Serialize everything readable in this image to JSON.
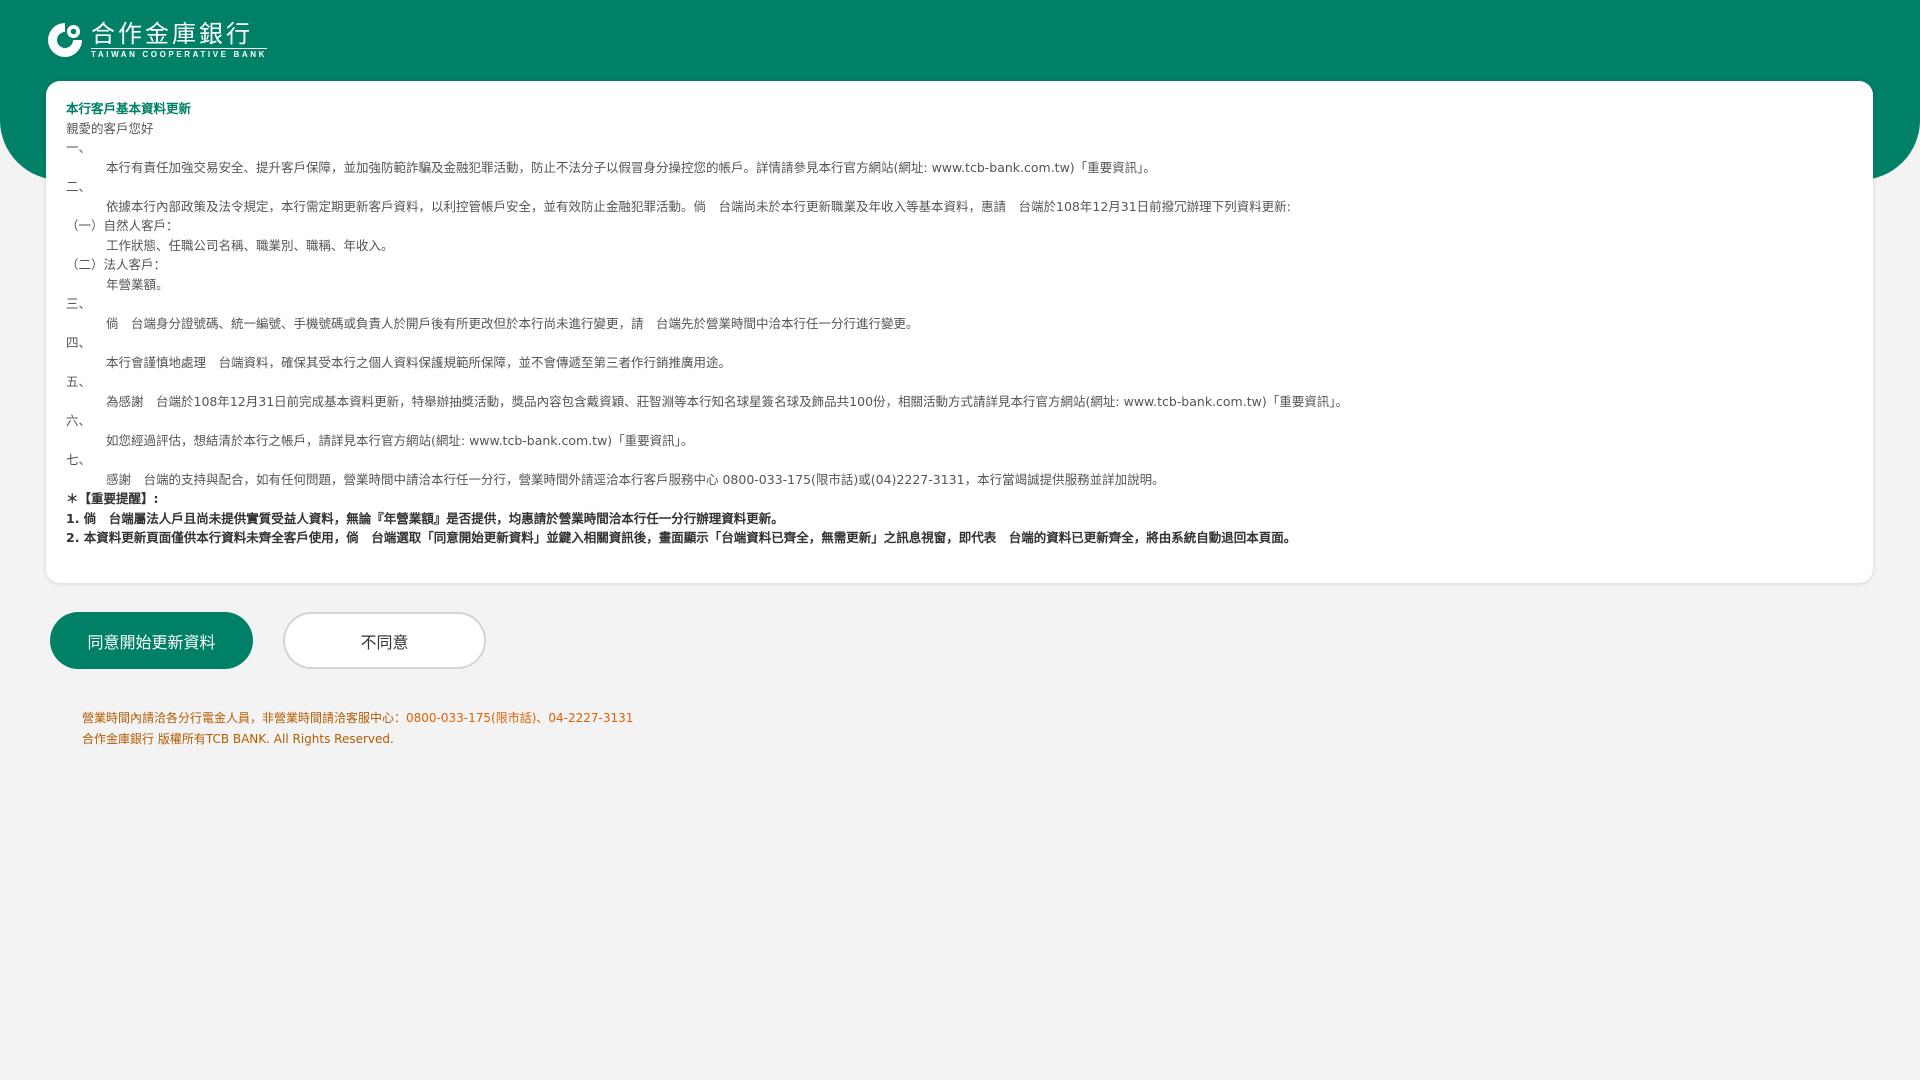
{
  "header": {
    "logo_cn": "合作金庫銀行",
    "logo_en": "TAIWAN COOPERATIVE BANK"
  },
  "notice": {
    "title": "本行客戶基本資料更新",
    "greeting": "親愛的客戶您好",
    "sections": [
      {
        "num": "一、",
        "text": "本行有責任加強交易安全、提升客戶保障，並加強防範詐騙及金融犯罪活動，防止不法分子以假冒身分操控您的帳戶。詳情請參見本行官方網站(網址: www.tcb-bank.com.tw)「重要資訊」。"
      },
      {
        "num": "二、",
        "text": "依據本行內部政策及法令規定，本行需定期更新客戶資料，以利控管帳戶安全，並有效防止金融犯罪活動。倘　台端尚未於本行更新職業及年收入等基本資料，惠請　台端於108年12月31日前撥冗辦理下列資料更新:"
      },
      {
        "num": "（一）",
        "text": "自然人客戶："
      },
      {
        "num": "",
        "text": "工作狀態、任職公司名稱、職業別、職稱、年收入。"
      },
      {
        "num": "（二）",
        "text": "法人客戶："
      },
      {
        "num": "",
        "text": "年營業額。"
      },
      {
        "num": "三、",
        "text": "倘　台端身分證號碼、統一編號、手機號碼或負責人於開戶後有所更改但於本行尚未進行變更，請　台端先於營業時間中洽本行任一分行進行變更。"
      },
      {
        "num": "四、",
        "text": "本行會謹慎地處理　台端資料，確保其受本行之個人資料保護規範所保障，並不會傳遞至第三者作行銷推廣用途。"
      },
      {
        "num": "五、",
        "text": "為感謝　台端於108年12月31日前完成基本資料更新，特舉辦抽獎活動，獎品內容包含戴資穎、莊智淵等本行知名球星簽名球及飾品共100份，相關活動方式請詳見本行官方網站(網址: www.tcb-bank.com.tw)「重要資訊」。"
      },
      {
        "num": "六、",
        "text": "如您經過評估，想結清於本行之帳戶，請詳見本行官方網站(網址: www.tcb-bank.com.tw)「重要資訊」。"
      },
      {
        "num": "七、",
        "text": "感謝　台端的支持與配合，如有任何問題，營業時間中請洽本行任一分行，營業時間外請逕洽本行客戶服務中心 0800-033-175(限市話)或(04)2227-3131，本行當竭誠提供服務並詳加說明。"
      }
    ],
    "important_heading": "＊【重要提醒】:",
    "important_1": "1. 倘　台端屬法人戶且尚未提供實質受益人資料，無論『年營業額』是否提供，均惠請於營業時間洽本行任一分行辦理資料更新。",
    "important_2": "2. 本資料更新頁面僅供本行資料未齊全客戶使用，倘　台端選取「同意開始更新資料」並鍵入相關資訊後，畫面顯示「台端資料已齊全，無需更新」之訊息視窗，即代表　台端的資料已更新齊全，將由系統自動退回本頁面。"
  },
  "actions": {
    "agree_label": "同意開始更新資料",
    "disagree_label": "不同意"
  },
  "footer": {
    "line1_text": "營業時間內請洽各分行電金人員，非營業時間請洽客服中心：",
    "line1_phones": "0800-033-175(限市話)、04-2227-3131",
    "line2": "合作金庫銀行 版權所有TCB BANK. All Rights Reserved."
  },
  "colors": {
    "brand_green": "#008066",
    "footer_text": "#b35c00",
    "footer_phone": "#e06000",
    "page_bg": "#f3f3f3"
  },
  "icons": {
    "logo": "tcb-logo-icon"
  }
}
